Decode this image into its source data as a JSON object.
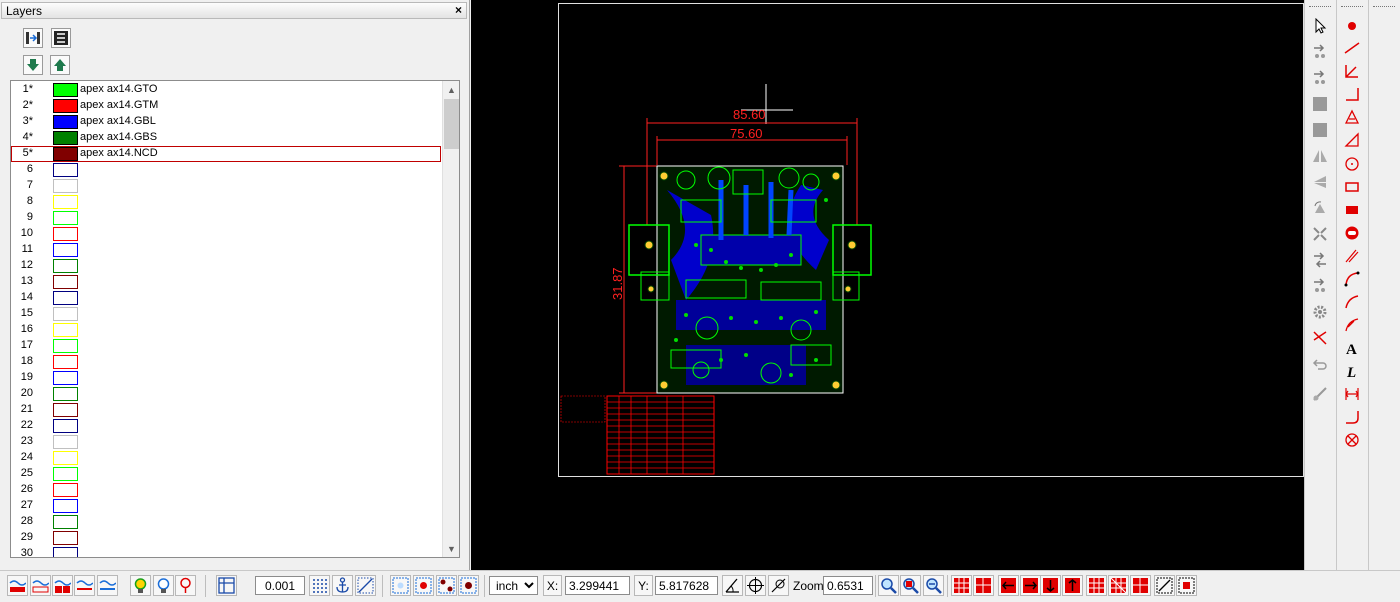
{
  "layers_panel": {
    "title": "Layers",
    "close_glyph": "×",
    "layers": [
      {
        "num": "1*",
        "color": "#00ff00",
        "name": "apex ax14.GTO"
      },
      {
        "num": "2*",
        "color": "#ff0000",
        "name": "apex ax14.GTM"
      },
      {
        "num": "3*",
        "color": "#0000ff",
        "name": "apex ax14.GBL"
      },
      {
        "num": "4*",
        "color": "#008000",
        "name": "apex ax14.GBS"
      },
      {
        "num": "5*",
        "color": "#800000",
        "name": "apex ax14.NCD",
        "selected": true
      },
      {
        "num": "6",
        "color": "#000080",
        "name": ""
      },
      {
        "num": "7",
        "color": "#c0c0c0",
        "name": ""
      },
      {
        "num": "8",
        "color": "#ffff00",
        "name": ""
      },
      {
        "num": "9",
        "color": "#00ff00",
        "name": ""
      },
      {
        "num": "10",
        "color": "#ff0000",
        "name": ""
      },
      {
        "num": "11",
        "color": "#0000ff",
        "name": ""
      },
      {
        "num": "12",
        "color": "#008000",
        "name": ""
      },
      {
        "num": "13",
        "color": "#800000",
        "name": ""
      },
      {
        "num": "14",
        "color": "#000080",
        "name": ""
      },
      {
        "num": "15",
        "color": "#c0c0c0",
        "name": ""
      },
      {
        "num": "16",
        "color": "#ffff00",
        "name": ""
      },
      {
        "num": "17",
        "color": "#00ff00",
        "name": ""
      },
      {
        "num": "18",
        "color": "#ff0000",
        "name": ""
      },
      {
        "num": "19",
        "color": "#0000ff",
        "name": ""
      },
      {
        "num": "20",
        "color": "#008000",
        "name": ""
      },
      {
        "num": "21",
        "color": "#800000",
        "name": ""
      },
      {
        "num": "22",
        "color": "#000080",
        "name": ""
      },
      {
        "num": "23",
        "color": "#c0c0c0",
        "name": ""
      },
      {
        "num": "24",
        "color": "#ffff00",
        "name": ""
      },
      {
        "num": "25",
        "color": "#00ff00",
        "name": ""
      },
      {
        "num": "26",
        "color": "#ff0000",
        "name": ""
      },
      {
        "num": "27",
        "color": "#0000ff",
        "name": ""
      },
      {
        "num": "28",
        "color": "#008000",
        "name": ""
      },
      {
        "num": "29",
        "color": "#800000",
        "name": ""
      },
      {
        "num": "30",
        "color": "#000080",
        "name": ""
      }
    ]
  },
  "canvas": {
    "dim_top_outer": "85.60",
    "dim_top_inner": "75.60",
    "dim_side": "31.87",
    "board_colors": {
      "silk": "#00ff00",
      "copper": "#0000ff",
      "mask": "#ff0000",
      "drill": "#800000"
    }
  },
  "bottom_bar": {
    "grid_value": "0.001",
    "unit": "inch",
    "x_label": "X:",
    "x_value": "3.299441",
    "y_label": "Y:",
    "y_value": "5.817628",
    "zoom_label": "Zoom:",
    "zoom_value": "0.6531"
  }
}
